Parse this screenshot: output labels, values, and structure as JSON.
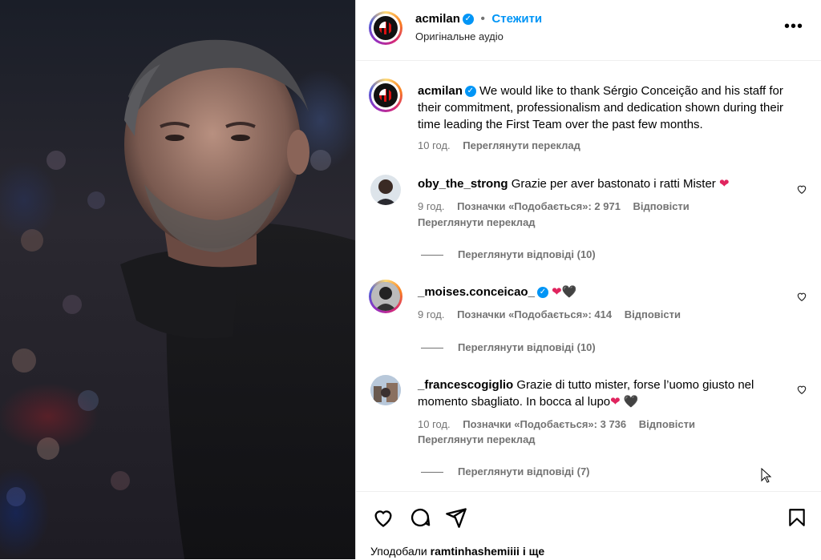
{
  "post": {
    "username": "acmilan",
    "follow_label": "Стежити",
    "audio_label": "Оригінальне аудіо",
    "more_label": "•••",
    "caption_text": "We would like to thank Sérgio Conceição and his staff for their commitment, professionalism and dedication shown during their time leading the First Team over the past few months.",
    "caption_time": "10 год.",
    "caption_translate": "Переглянути переклад"
  },
  "comments": [
    {
      "username": "oby_the_strong",
      "text": "Grazie per aver bastonato i ratti Mister",
      "emojis": [
        "❤"
      ],
      "time": "9 год.",
      "likes": "Позначки «Подобається»: 2 971",
      "reply_label": "Відповісти",
      "translate_label": "Переглянути переклад",
      "view_replies": "Переглянути відповіді (10)"
    },
    {
      "username": "_moises.conceicao_",
      "verified": true,
      "text": "",
      "emojis": [
        "❤",
        "🖤"
      ],
      "time": "9 год.",
      "likes": "Позначки «Подобається»: 414",
      "reply_label": "Відповісти",
      "view_replies": "Переглянути відповіді (10)"
    },
    {
      "username": "_francescogiglio",
      "text": "Grazie di tutto mister, forse l’uomo giusto nel momento sbagliato. In bocca al lupo",
      "emojis": [
        "❤",
        "🖤"
      ],
      "time": "10 год.",
      "likes": "Позначки «Подобається»: 3 736",
      "reply_label": "Відповісти",
      "translate_label": "Переглянути переклад",
      "view_replies": "Переглянути відповіді (7)"
    }
  ],
  "footer": {
    "liked_prefix": "Уподобали",
    "liked_user": "ramtinhashemiiii",
    "liked_suffix": "і ще"
  },
  "icons": [
    "heart-icon",
    "comment-icon",
    "share-icon",
    "bookmark-icon",
    "more-icon",
    "verified-icon"
  ],
  "colors": {
    "accent": "#0095f6",
    "muted": "#737373",
    "heart": "#e0245e"
  }
}
